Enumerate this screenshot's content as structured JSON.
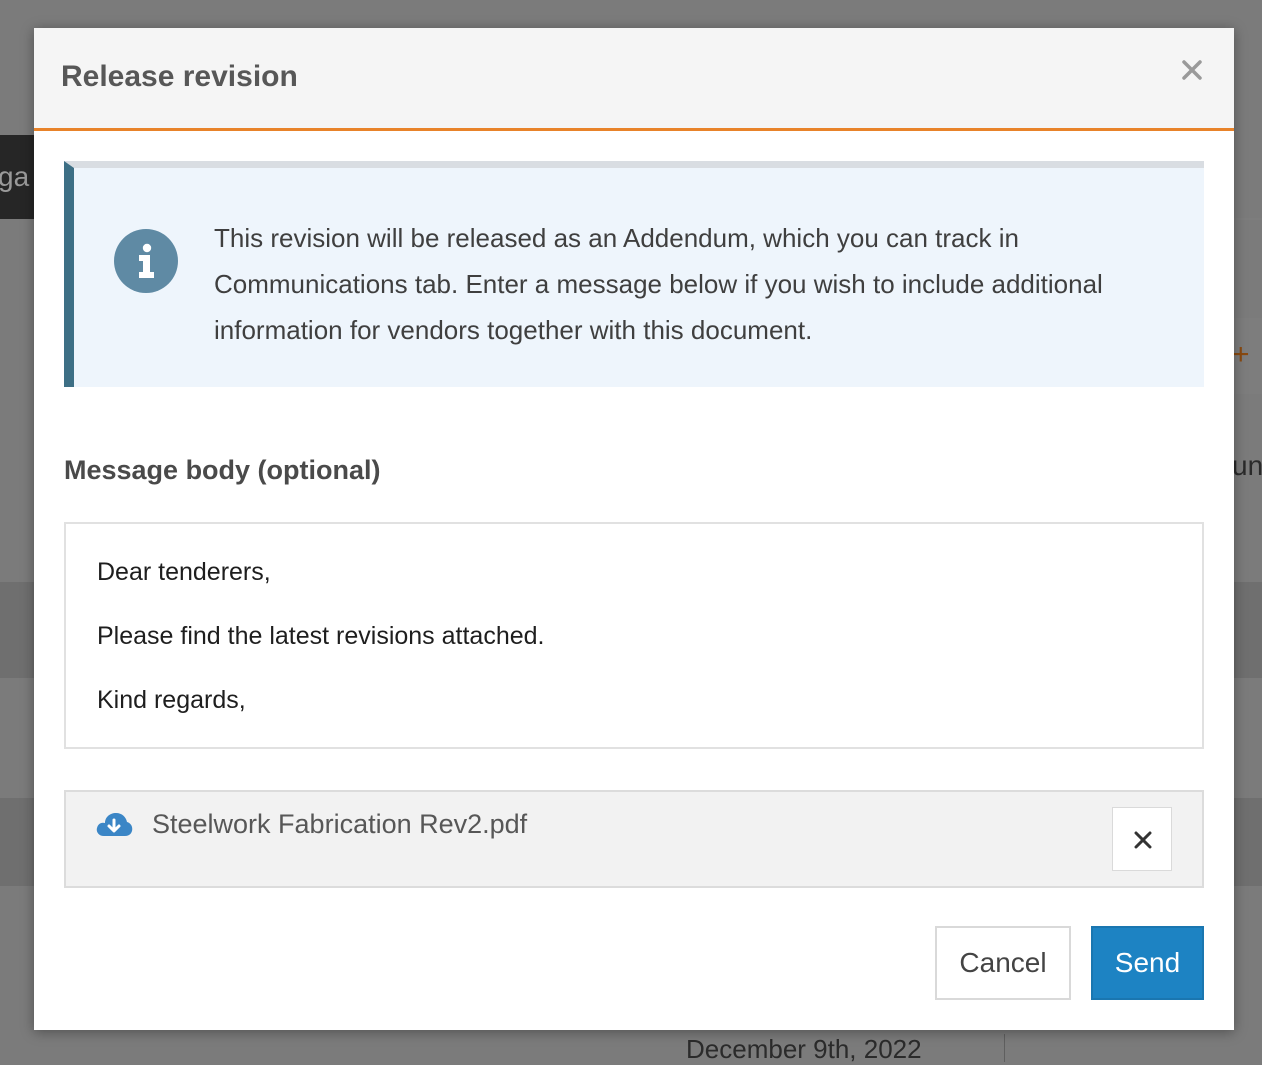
{
  "background": {
    "left_tab_text": "ga",
    "right_plus": "+",
    "right_partial_text": "un",
    "bottom_date": "December 9th, 2022"
  },
  "modal": {
    "title": "Release revision",
    "close_icon": "close-icon",
    "info": {
      "icon": "info-icon",
      "text": "This revision will be released as an Addendum, which you can track in Communications tab. Enter a message below if you wish to include additional information for vendors together with this document."
    },
    "message_label": "Message body (optional)",
    "message_lines": [
      "Dear tenderers,",
      "Please find the latest revisions attached.",
      "Kind regards,"
    ],
    "attachment": {
      "icon": "cloud-download-icon",
      "file_name": "Steelwork Fabrication Rev2.pdf",
      "remove_icon": "remove-icon"
    },
    "buttons": {
      "cancel": "Cancel",
      "send": "Send"
    }
  },
  "colors": {
    "accent_orange": "#e8832a",
    "info_border": "#3d6f85",
    "info_background": "#eef5fc",
    "primary_button": "#1d83c3"
  }
}
